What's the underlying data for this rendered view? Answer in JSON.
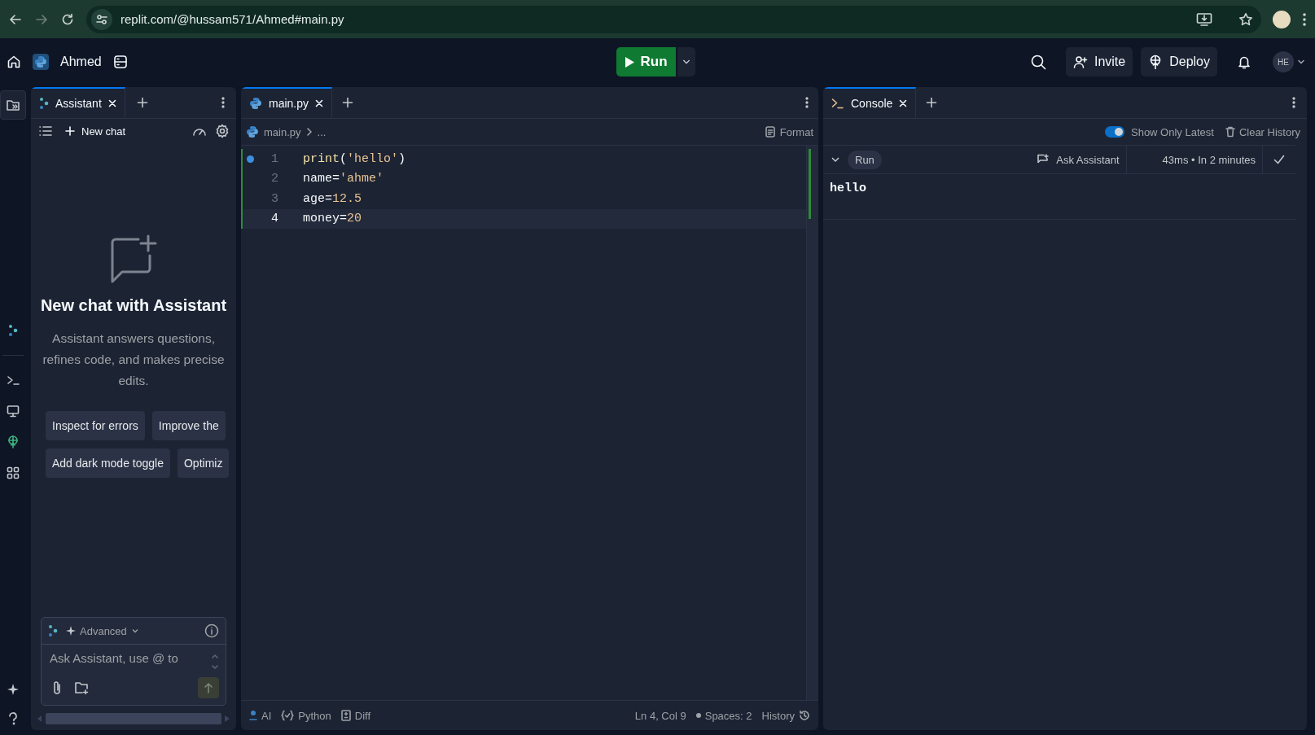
{
  "browser": {
    "url": "replit.com/@hussam571/Ahmed#main.py"
  },
  "header": {
    "project_name": "Ahmed",
    "run_button": "Run",
    "actions": [
      {
        "label": "Invite",
        "kind": "invite"
      },
      {
        "label": "Deploy",
        "kind": "deploy"
      }
    ],
    "avatar": "HE"
  },
  "assistant": {
    "tab": "Assistant",
    "new_chat": "New chat",
    "title": "New chat with Assistant",
    "description": "Assistant answers questions, refines code, and makes precise edits.",
    "suggestions": [
      [
        "Inspect for errors",
        "Improve the"
      ],
      [
        "Add dark mode toggle",
        "Optimiz"
      ]
    ],
    "mode": "Advanced",
    "input": {
      "placeholder": "Ask Assistant, use @ to"
    }
  },
  "editor": {
    "tabs": [
      {
        "label": "main.py",
        "selected": true
      }
    ],
    "breadcrumb": [
      "main.py",
      "..."
    ],
    "format": "Format",
    "lines": [
      {
        "number": "1",
        "marker": true,
        "current": false,
        "tokens": [
          {
            "text": "print",
            "kind": "fn"
          },
          {
            "text": "(",
            "kind": "punct"
          },
          {
            "text": "'hello'",
            "kind": "str"
          },
          {
            "text": ")",
            "kind": "punct"
          }
        ]
      },
      {
        "number": "2",
        "marker": false,
        "current": false,
        "tokens": [
          {
            "text": "name",
            "kind": "var"
          },
          {
            "text": "=",
            "kind": "punct"
          },
          {
            "text": "'ahme'",
            "kind": "str"
          }
        ]
      },
      {
        "number": "3",
        "marker": false,
        "current": false,
        "tokens": [
          {
            "text": "age",
            "kind": "var"
          },
          {
            "text": "=",
            "kind": "punct"
          },
          {
            "text": "12.5",
            "kind": "num"
          }
        ]
      },
      {
        "number": "4",
        "marker": false,
        "current": true,
        "tokens": [
          {
            "text": "money",
            "kind": "var"
          },
          {
            "text": "=",
            "kind": "punct"
          },
          {
            "text": "20",
            "kind": "num"
          }
        ]
      }
    ]
  },
  "status_bar": {
    "left": [
      {
        "label": "AI",
        "kind": "ai"
      },
      {
        "label": "Python",
        "kind": "lang"
      },
      {
        "label": "Diff",
        "kind": "diff"
      }
    ],
    "right": [
      {
        "label": "Ln 4, Col 9",
        "kind": "plain"
      },
      {
        "label": "Spaces: 2",
        "kind": "dot"
      },
      {
        "label": "History",
        "kind": "history"
      }
    ]
  },
  "console": {
    "tab": "Console",
    "show_only_latest": {
      "label": "Show Only Latest",
      "on": true
    },
    "clear": "Clear History",
    "entries": [
      {
        "label": "Run",
        "ask": "Ask Assistant",
        "timing": "43ms • In 2 minutes",
        "success": true,
        "expanded": true,
        "output": "hello"
      }
    ]
  }
}
